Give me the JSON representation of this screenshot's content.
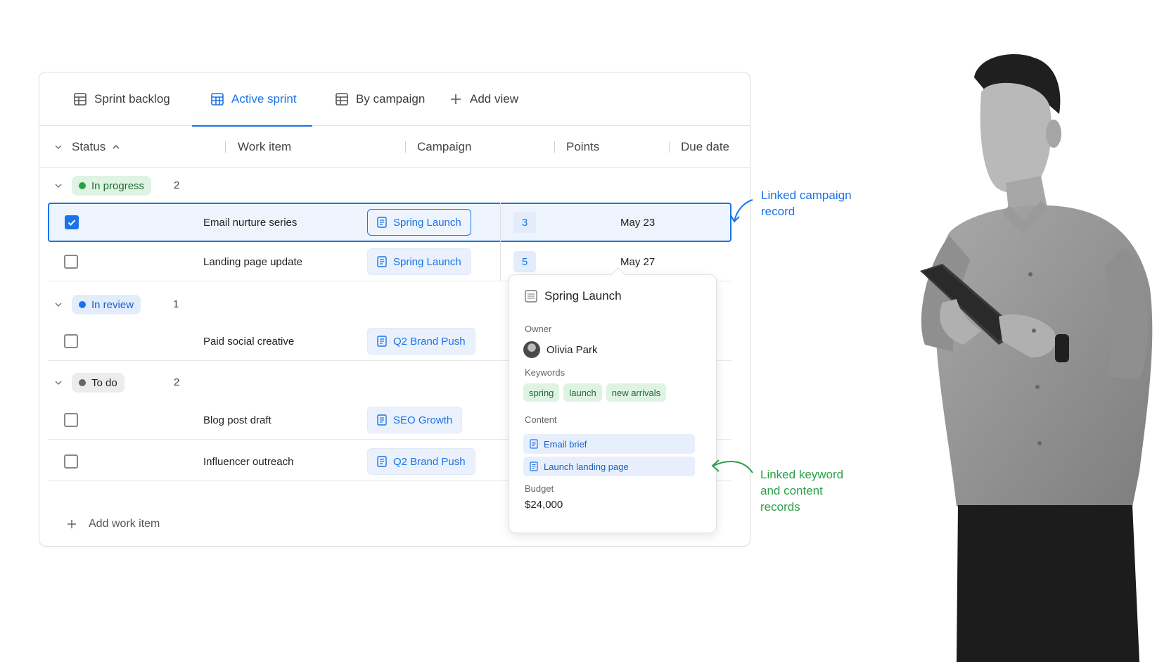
{
  "tabs": [
    {
      "label": "Sprint backlog",
      "active": false
    },
    {
      "label": "Active sprint",
      "active": true
    },
    {
      "label": "By campaign",
      "active": false
    },
    {
      "label": "Add view",
      "active": false
    }
  ],
  "columns": {
    "status": "Status",
    "work_item": "Work item",
    "campaign": "Campaign",
    "points": "Points",
    "due_date": "Due date"
  },
  "groups": [
    {
      "label": "In progress",
      "count": "2",
      "color": "#2aa048",
      "bg": "#dff3e3"
    },
    {
      "label": "In review",
      "count": "1",
      "color": "#1a73e8",
      "bg": "#e3ecfb"
    },
    {
      "label": "To do",
      "count": "2",
      "color": "#666666",
      "bg": "#ececec"
    }
  ],
  "rows": [
    {
      "work_item": "Email nurture series",
      "campaign": "Spring Launch",
      "points": "3",
      "due": "May 23",
      "checked": true
    },
    {
      "work_item": "Landing page update",
      "campaign": "Spring Launch",
      "points": "5",
      "due": "May 27",
      "checked": false
    },
    {
      "work_item": "Paid social creative",
      "campaign": "Q2 Brand Push",
      "checked": false
    },
    {
      "work_item": "Blog post draft",
      "campaign": "SEO Growth",
      "checked": false
    },
    {
      "work_item": "Influencer outreach",
      "campaign": "Q2 Brand Push",
      "checked": false
    }
  ],
  "add_work_item": "Add work item",
  "popover": {
    "title": "Spring Launch",
    "owner_label": "Owner",
    "owner": "Olivia Park",
    "keywords_label": "Keywords",
    "keywords": [
      "spring",
      "launch",
      "new arrivals"
    ],
    "content_label": "Content",
    "content": [
      "Email brief",
      "Launch landing page"
    ],
    "budget_label": "Budget",
    "budget": "$24,000"
  },
  "annotations": {
    "campaign": [
      "Linked campaign",
      "record"
    ],
    "keyword": [
      "Linked keyword",
      "and content",
      "records"
    ]
  },
  "colors": {
    "accent": "#1a73e8",
    "green": "#2aa048"
  }
}
